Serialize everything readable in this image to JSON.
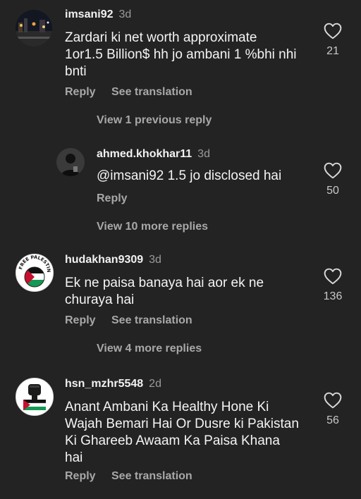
{
  "comments": [
    {
      "username": "imsani92",
      "time": "3d",
      "text_lines": [
        "Zardari ki net worth approximate",
        "1or1.5 Billion$ hh jo ambani 1 %bhi nhi",
        "bnti"
      ],
      "likes": "21",
      "reply_label": "Reply",
      "translate_label": "See translation",
      "view_replies_label": "View 1 previous reply"
    },
    {
      "username": "ahmed.khokhar11",
      "time": "3d",
      "text": "@imsani92 1.5 jo disclosed hai",
      "likes": "50",
      "reply_label": "Reply",
      "view_replies_label": "View 10 more replies"
    },
    {
      "username": "hudakhan9309",
      "time": "3d",
      "text_lines": [
        "Ek ne paisa banaya hai aor ek ne",
        "churaya hai"
      ],
      "likes": "136",
      "reply_label": "Reply",
      "translate_label": "See translation",
      "view_replies_label": "View 4 more replies",
      "avatar_text": "FREE PALESTINE"
    },
    {
      "username": "hsn_mzhr5548",
      "time": "2d",
      "text_lines": [
        "Anant Ambani Ka Healthy Hone Ki",
        "Wajah Bemari Hai Or Dusre ki Pakistan",
        "Ki Ghareeb Awaam Ka Paisa Khana",
        "hai"
      ],
      "likes": "56",
      "reply_label": "Reply",
      "translate_label": "See translation"
    }
  ],
  "colors": {
    "background": "#232323",
    "text": "#f2f2f2",
    "muted": "#a8a8a8",
    "palestine_red": "#c8102e",
    "palestine_green": "#149954"
  },
  "icons": {
    "like": "heart-outline-icon"
  }
}
